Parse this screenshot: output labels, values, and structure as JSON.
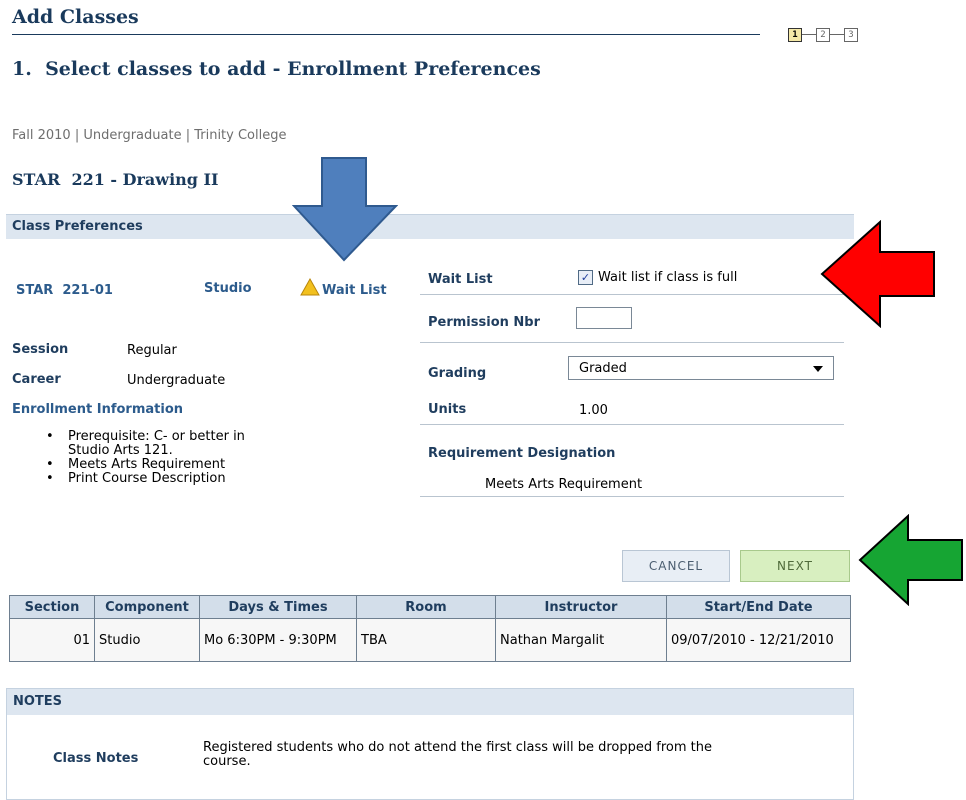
{
  "header": {
    "title": "Add Classes",
    "subtitle": "1.  Select classes to add - Enrollment Preferences",
    "steps": [
      "1",
      "2",
      "3"
    ]
  },
  "context": "Fall 2010 | Undergraduate | Trinity College",
  "course_title": "STAR  221 - Drawing II",
  "class_preferences": {
    "heading": "Class Preferences",
    "section_code": "STAR  221-01",
    "component": "Studio",
    "wait_list_flag": "Wait List",
    "session_label": "Session",
    "session_value": "Regular",
    "career_label": "Career",
    "career_value": "Undergraduate",
    "enrollment_info_label": "Enrollment Information",
    "enrollment_info": [
      "Prerequisite: C- or better in",
      "Studio Arts 121.",
      "Meets Arts Requirement",
      "Print Course Description"
    ]
  },
  "preferences_form": {
    "wait_list_label": "Wait List",
    "wait_list_checkbox_label": "Wait list if class is full",
    "wait_list_checked": true,
    "permission_label": "Permission Nbr",
    "permission_value": "",
    "grading_label": "Grading",
    "grading_value": "Graded",
    "units_label": "Units",
    "units_value": "1.00",
    "requirement_label": "Requirement Designation",
    "requirement_value": "Meets Arts Requirement"
  },
  "buttons": {
    "cancel": "CANCEL",
    "next": "NEXT"
  },
  "sections_table": {
    "headers": [
      "Section",
      "Component",
      "Days & Times",
      "Room",
      "Instructor",
      "Start/End Date"
    ],
    "rows": [
      {
        "section": "01",
        "component": "Studio",
        "days_times": "Mo 6:30PM - 9:30PM",
        "room": "TBA",
        "instructor": "Nathan Margalit",
        "dates": "09/07/2010 - 12/21/2010"
      }
    ]
  },
  "notes": {
    "heading": "NOTES",
    "class_notes_label": "Class Notes",
    "class_notes_text": "Registered students who do not attend the first class will be dropped from the course."
  },
  "colors": {
    "blue_arrow": "#4f7fbd",
    "red_arrow": "#ff0000",
    "green_arrow": "#16a533"
  }
}
